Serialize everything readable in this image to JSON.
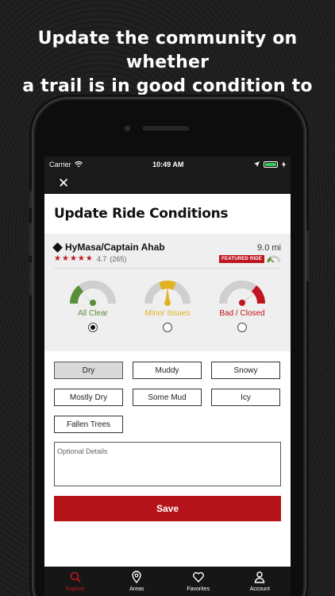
{
  "headline": {
    "line1": "Update the community on whether",
    "line2": "a trail is in good condition to ride."
  },
  "status_bar": {
    "carrier": "Carrier",
    "time": "10:49 AM"
  },
  "page": {
    "title": "Update Ride Conditions"
  },
  "trail": {
    "name": "HyMasa/Captain Ahab",
    "distance": "9.0 mi",
    "rating": "4.7",
    "rating_count": "(265)",
    "star_fill_fraction": 0.94,
    "featured_label": "FEATURED RIDE",
    "difficulty_icon": "black-diamond-icon"
  },
  "conditions": [
    {
      "label": "All Clear",
      "color": "#5a8f3a",
      "selected": true,
      "icon": "gauge-all-clear-icon"
    },
    {
      "label": "Minor Issues",
      "color": "#e0b21f",
      "selected": false,
      "icon": "gauge-minor-issues-icon"
    },
    {
      "label": "Bad / Closed",
      "color": "#c0151e",
      "selected": false,
      "icon": "gauge-bad-closed-icon"
    }
  ],
  "surface_options": [
    {
      "label": "Dry",
      "selected": true
    },
    {
      "label": "Muddy",
      "selected": false
    },
    {
      "label": "Snowy",
      "selected": false
    },
    {
      "label": "Mostly Dry",
      "selected": false
    },
    {
      "label": "Some Mud",
      "selected": false
    },
    {
      "label": "Icy",
      "selected": false
    },
    {
      "label": "Fallen Trees",
      "selected": false
    }
  ],
  "details": {
    "placeholder": "Optional Details"
  },
  "save_label": "Save",
  "tabs": [
    {
      "label": "Explore",
      "icon": "search-icon",
      "active": true
    },
    {
      "label": "Areas",
      "icon": "map-pin-icon",
      "active": false
    },
    {
      "label": "Favorites",
      "icon": "heart-icon",
      "active": false
    },
    {
      "label": "Account",
      "icon": "person-icon",
      "active": false
    }
  ],
  "colors": {
    "accent": "#c0151e",
    "save_button": "#b41419",
    "card_bg": "#efefef"
  }
}
